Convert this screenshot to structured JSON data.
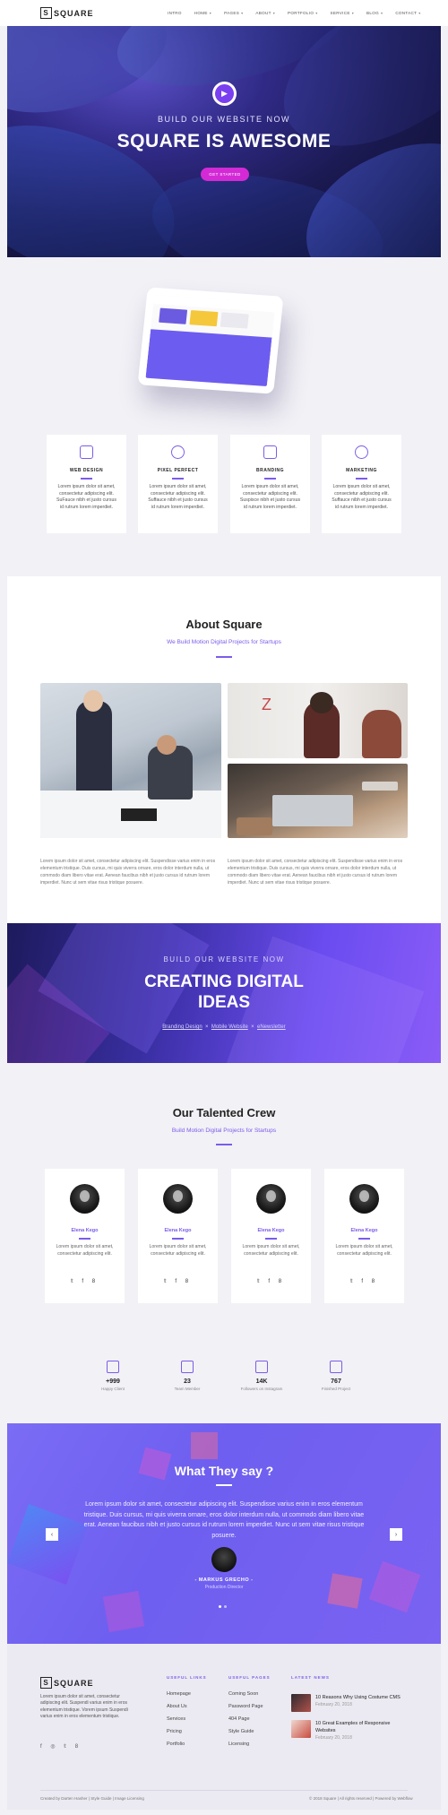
{
  "nav": {
    "logo": "SQUARE",
    "logo_letter": "S",
    "links": [
      "INTRO",
      "HOME",
      "PAGES",
      "ABOUT",
      "PORTFOLIO",
      "SERVICE",
      "BLOG",
      "CONTACT"
    ]
  },
  "hero": {
    "kicker": "BUILD OUR WEBSITE NOW",
    "title": "SQUARE IS AWESOME",
    "button": "GET STARTED"
  },
  "services": [
    {
      "title": "WEB DESIGN",
      "text": "Lorem ipsum dolor sit amet, consectetur adipiscing elit. SuFauce nibh et justo cursus id rutrum lorem imperdiet."
    },
    {
      "title": "PIXEL PERFECT",
      "text": "Lorem ipsum dolor sit amet, consectetur adipiscing elit. Suffauce nibh et justo cursus id rutrum lorem imperdiet."
    },
    {
      "title": "BRANDING",
      "text": "Lorem ipsum dolor sit amet, consectetur adipiscing elit. Suspisce nibh et justo cursus id rutrum lorem imperdiet."
    },
    {
      "title": "MARKETING",
      "text": "Lorem ipsum dolor sit amet, consectetur adipiscing elit. Suffauce nibh et justo cursus id rutrum lorem imperdiet."
    }
  ],
  "about": {
    "title": "About Square",
    "subtitle": "We Build Motion Digital Projects for Startups",
    "text_left": "Lorem ipsum dolor sit amet, consectetur adipiscing elit. Suspendisse varius enim in eros elementum tristique. Duis cursus, mi quis viverra ornare, eros dolor interdum nulla, ut commodo diam libero vitae erat. Aenean faucibus nibh et justo cursus id rutrum lorem imperdiet. Nunc ut sem vitae risus tristique posuere.",
    "text_right": "Lorem ipsum dolor sit amet, consectetur adipiscing elit. Suspendisse varius enim in eros elementum tristique. Duis cursus, mi quis viverra ornare, eros dolor interdum nulla, ut commodo diam libero vitae erat. Aenean faucibus nibh et justo cursus id rutrum lorem imperdiet. Nunc ut sem vitae risus tristique posuere."
  },
  "banner": {
    "kicker": "BUILD OUR WEBSITE NOW",
    "title_line1": "CREATING DIGITAL",
    "title_line2": "IDEAS",
    "crumb1": "Branding Design",
    "crumb2": "Mobile Website",
    "crumb3": "eNewsletter",
    "sep": "×"
  },
  "team": {
    "title": "Our Talented Crew",
    "subtitle": "Build Motion Digital Projects for Startups",
    "members": [
      {
        "name": "Elena Kego",
        "text": "Lorem ipsum dolor sit amet, consectetur adipiscing elit."
      },
      {
        "name": "Elena Kego",
        "text": "Lorem ipsum dolor sit amet, consectetur adipiscing elit."
      },
      {
        "name": "Elena Kego",
        "text": "Lorem ipsum dolor sit amet, consectetur adipiscing elit."
      },
      {
        "name": "Elena Kego",
        "text": "Lorem ipsum dolor sit amet, consectetur adipiscing elit."
      }
    ],
    "social": "𝕥 f 8"
  },
  "stats": [
    {
      "num": "+999",
      "label": "Happy Client"
    },
    {
      "num": "23",
      "label": "Team Member"
    },
    {
      "num": "14K",
      "label": "Followers on Instagram"
    },
    {
      "num": "767",
      "label": "Finished Project"
    }
  ],
  "testimonials": {
    "title": "What They say ?",
    "text": "Lorem ipsum dolor sit amet, consectetur adipiscing elit. Suspendisse varius enim in eros elementum tristique. Duis cursus, mi quis viverra ornare, eros dolor interdum nulla, ut commodo diam libero vitae erat. Aenean faucibus nibh et justo cursus id rutrum lorem imperdiet. Nunc ut sem vitae risus tristique posuere.",
    "name": "- MARKUS GRECHO -",
    "role": "Production Director",
    "prev": "‹",
    "next": "›"
  },
  "footer": {
    "logo": "SQUARE",
    "about": "Lorem ipsum dolor sit amet, consectetur adipiscing elit. Suspendi varius enim in eros elementum tristique. Vorem ipsum Suspendi varius enim in eros elementum tristique.",
    "social": "f ◎ 𝕥 8",
    "useful_links_head": "USEFUL LINKS",
    "useful_links": [
      "Homepage",
      "About Us",
      "Services",
      "Pricing",
      "Portfolio"
    ],
    "useful_pages_head": "USEFUL PAGES",
    "useful_pages": [
      "Coming Soon",
      "Password Page",
      "404 Page",
      "Style Guide",
      "Licensing"
    ],
    "news_head": "LATEST NEWS",
    "news": [
      {
        "title": "10 Reasons Why Using Costume CMS",
        "date": "February 20, 2018"
      },
      {
        "title": "10 Great Examples of Responsive Websites",
        "date": "February 20, 2018"
      }
    ],
    "credit_left": "Created by Darten Hasher | Style Guide | Image Licensing",
    "credit_right": "© 2018 Square | All rights reserved | Powered by Webflow"
  },
  "colors": {
    "accent": "#7c5ce8",
    "hero_button": "#d32ad6",
    "testimonial_bg": "#7566f2"
  }
}
